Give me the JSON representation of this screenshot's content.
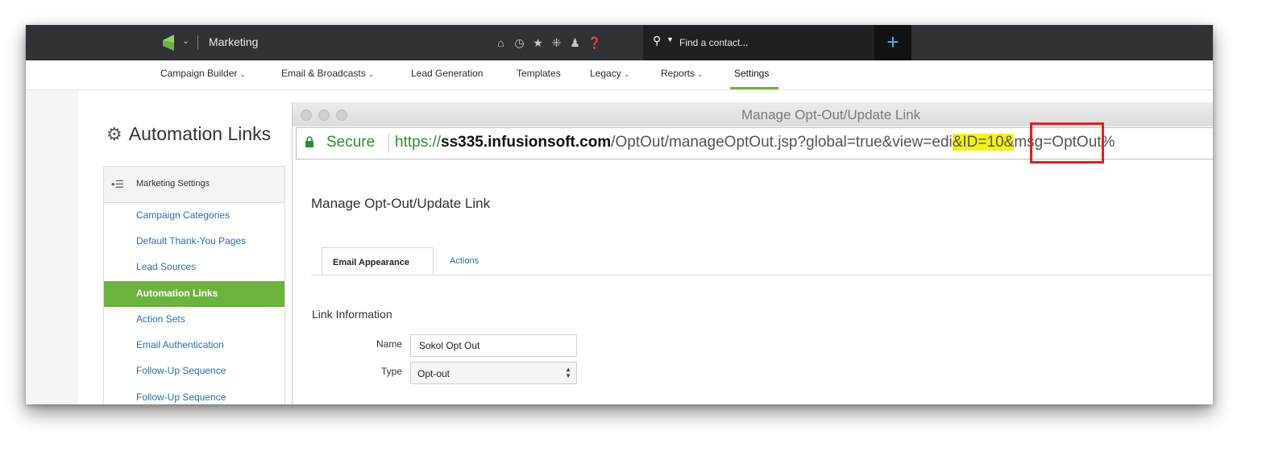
{
  "topbar": {
    "app_name": "Marketing",
    "icons": [
      "home-icon",
      "clock-icon",
      "star-icon",
      "tag-icon",
      "person-icon",
      "help-icon"
    ],
    "search_placeholder": "Find a contact...",
    "add_button_label": "+"
  },
  "nav": {
    "items": [
      {
        "label": "Campaign Builder",
        "dropdown": true
      },
      {
        "label": "Email & Broadcasts",
        "dropdown": true
      },
      {
        "label": "Lead Generation",
        "dropdown": false
      },
      {
        "label": "Templates",
        "dropdown": false
      },
      {
        "label": "Legacy",
        "dropdown": true
      },
      {
        "label": "Reports",
        "dropdown": true
      },
      {
        "label": "Settings",
        "dropdown": false,
        "active": true
      }
    ]
  },
  "page": {
    "title": "Automation Links"
  },
  "sidebar": {
    "header": "Marketing Settings",
    "items": [
      {
        "label": "Campaign Categories"
      },
      {
        "label": "Default Thank-You Pages"
      },
      {
        "label": "Lead Sources"
      },
      {
        "label": "Automation Links",
        "active": true
      },
      {
        "label": "Action Sets"
      },
      {
        "label": "Email Authentication"
      },
      {
        "label": "Follow-Up Sequence"
      },
      {
        "label": "Follow-Up Sequence"
      }
    ]
  },
  "browser": {
    "window_title": "Manage Opt-Out/Update Link",
    "secure_label": "Secure",
    "url": {
      "scheme": "https://",
      "domain": "ss335.infusionsoft.com",
      "path": "/OptOut/manageOptOut.jsp?global=true&view=edi",
      "highlight": "&ID=10&",
      "rest": "msg=OptOut%"
    }
  },
  "form": {
    "heading": "Manage Opt-Out/Update Link",
    "tabs": [
      {
        "label": "Email Appearance",
        "active": true
      },
      {
        "label": "Actions",
        "active": false
      }
    ],
    "section_title": "Link Information",
    "name_label": "Name",
    "name_value": "Sokol Opt Out",
    "type_label": "Type",
    "type_value": "Opt-out"
  },
  "colors": {
    "accent_green": "#6cb33e",
    "link_blue": "#2a6db4",
    "highlight_yellow": "#f2f217",
    "annotation_red": "#e41e1e"
  }
}
